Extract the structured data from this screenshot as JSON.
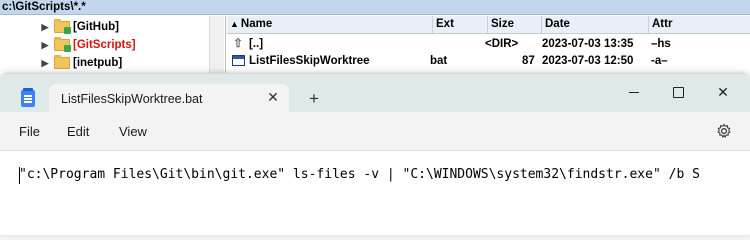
{
  "tc": {
    "path": "c:\\GitScripts\\*.*",
    "tree": [
      {
        "label": "[GitHub]",
        "selected": false
      },
      {
        "label": "[GitScripts]",
        "selected": true
      },
      {
        "label": "[inetpub]",
        "selected": false
      }
    ],
    "columns": {
      "name": "Name",
      "ext": "Ext",
      "size": "Size",
      "date": "Date",
      "attr": "Attr"
    },
    "rows": [
      {
        "name": "[..]",
        "ext": "",
        "size": "<DIR>",
        "date": "2023-07-03 13:35",
        "attr": "–hs"
      },
      {
        "name": "ListFilesSkipWorktree",
        "ext": "bat",
        "size": "87",
        "date": "2023-07-03 12:50",
        "attr": "-a–"
      }
    ]
  },
  "notepad": {
    "tab_title": "ListFilesSkipWorktree.bat",
    "tab_close": "✕",
    "new_tab": "+",
    "win": {
      "minimize": "",
      "maximize": "",
      "close": "✕"
    },
    "menu": [
      "File",
      "Edit",
      "View"
    ],
    "content": "\"c:\\Program Files\\Git\\bin\\git.exe\" ls-files -v | \"C:\\WINDOWS\\system32\\findstr.exe\" /b S"
  },
  "colors": {
    "accent": "#3b82f6",
    "selected_folder_text": "#d4140f",
    "path_bar": "#c3d7ec"
  }
}
